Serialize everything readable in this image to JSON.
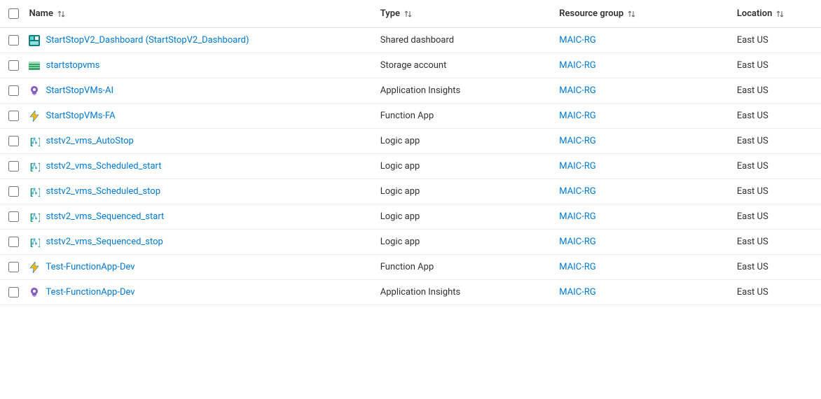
{
  "columns": {
    "name": "Name",
    "type": "Type",
    "resource_group": "Resource group",
    "location": "Location"
  },
  "icon_names": {
    "dashboard": "dashboard-icon",
    "storage": "storage-account-icon",
    "appinsights": "application-insights-icon",
    "functionapp": "function-app-icon",
    "logicapp": "logic-app-icon",
    "sort": "sort-updown-icon"
  },
  "resources": [
    {
      "name": "StartStopV2_Dashboard (StartStopV2_Dashboard)",
      "type": "Shared dashboard",
      "rg": "MAIC-RG",
      "loc": "East US",
      "icon": "dashboard"
    },
    {
      "name": "startstopvms",
      "type": "Storage account",
      "rg": "MAIC-RG",
      "loc": "East US",
      "icon": "storage"
    },
    {
      "name": "StartStopVMs-AI",
      "type": "Application Insights",
      "rg": "MAIC-RG",
      "loc": "East US",
      "icon": "appinsights"
    },
    {
      "name": "StartStopVMs-FA",
      "type": "Function App",
      "rg": "MAIC-RG",
      "loc": "East US",
      "icon": "functionapp"
    },
    {
      "name": "ststv2_vms_AutoStop",
      "type": "Logic app",
      "rg": "MAIC-RG",
      "loc": "East US",
      "icon": "logicapp"
    },
    {
      "name": "ststv2_vms_Scheduled_start",
      "type": "Logic app",
      "rg": "MAIC-RG",
      "loc": "East US",
      "icon": "logicapp"
    },
    {
      "name": "ststv2_vms_Scheduled_stop",
      "type": "Logic app",
      "rg": "MAIC-RG",
      "loc": "East US",
      "icon": "logicapp"
    },
    {
      "name": "ststv2_vms_Sequenced_start",
      "type": "Logic app",
      "rg": "MAIC-RG",
      "loc": "East US",
      "icon": "logicapp"
    },
    {
      "name": "ststv2_vms_Sequenced_stop",
      "type": "Logic app",
      "rg": "MAIC-RG",
      "loc": "East US",
      "icon": "logicapp"
    },
    {
      "name": "Test-FunctionApp-Dev",
      "type": "Function App",
      "rg": "MAIC-RG",
      "loc": "East US",
      "icon": "functionapp"
    },
    {
      "name": "Test-FunctionApp-Dev",
      "type": "Application Insights",
      "rg": "MAIC-RG",
      "loc": "East US",
      "icon": "appinsights"
    }
  ]
}
